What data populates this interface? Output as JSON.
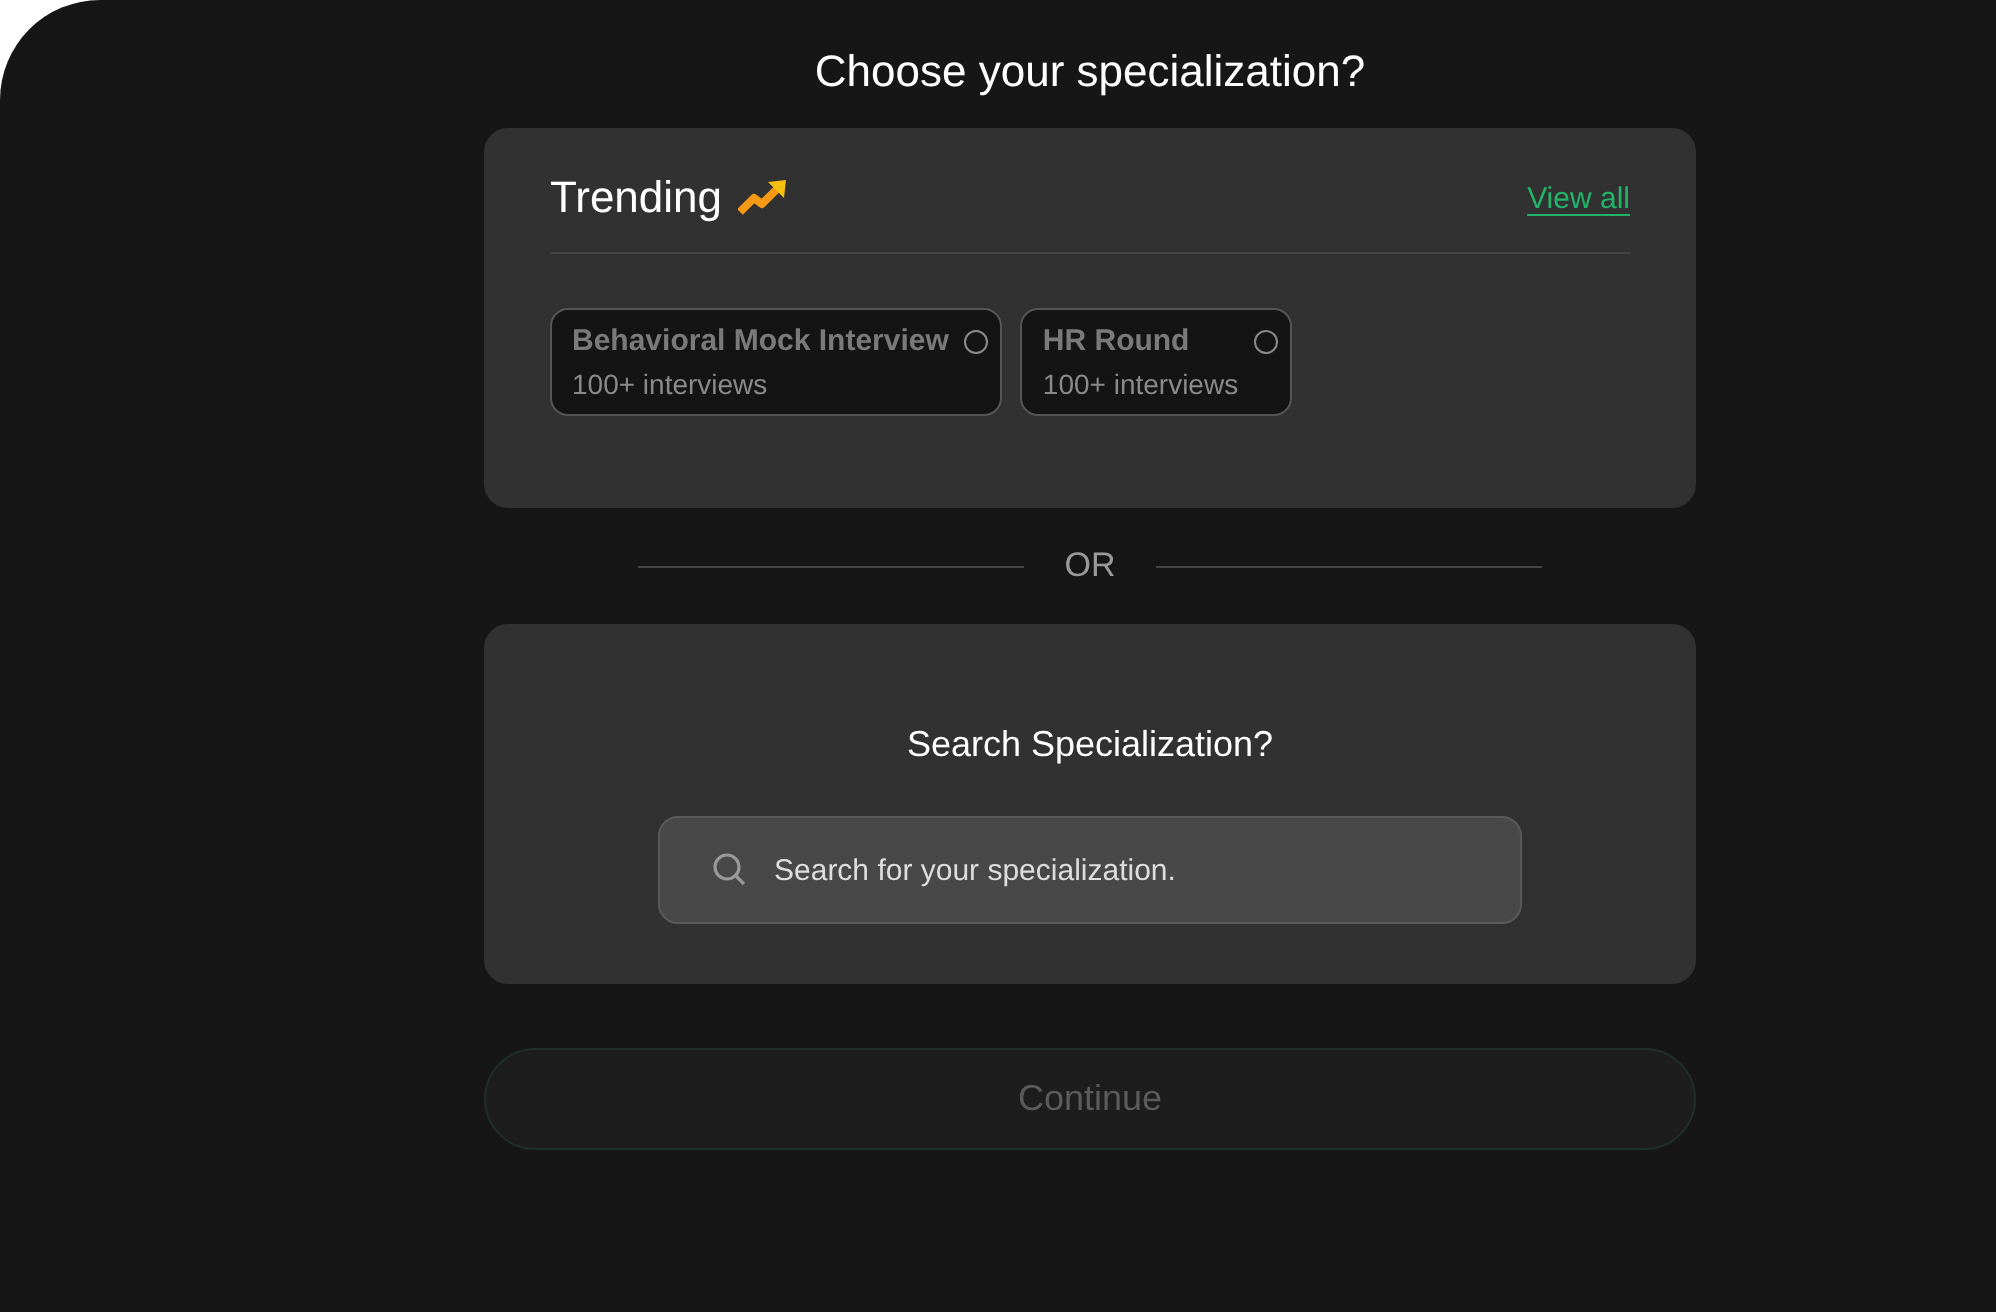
{
  "title": "Choose your specialization?",
  "trending": {
    "heading": "Trending",
    "view_all": "View all",
    "options": [
      {
        "name": "Behavioral Mock Interview",
        "count": "100+ interviews",
        "selected": false
      },
      {
        "name": "HR Round",
        "count": "100+ interviews",
        "selected": false
      }
    ]
  },
  "divider": "OR",
  "search": {
    "heading": "Search Specialization?",
    "placeholder": "Search for your specialization."
  },
  "continue_button": {
    "label": "Continue",
    "disabled": true
  }
}
